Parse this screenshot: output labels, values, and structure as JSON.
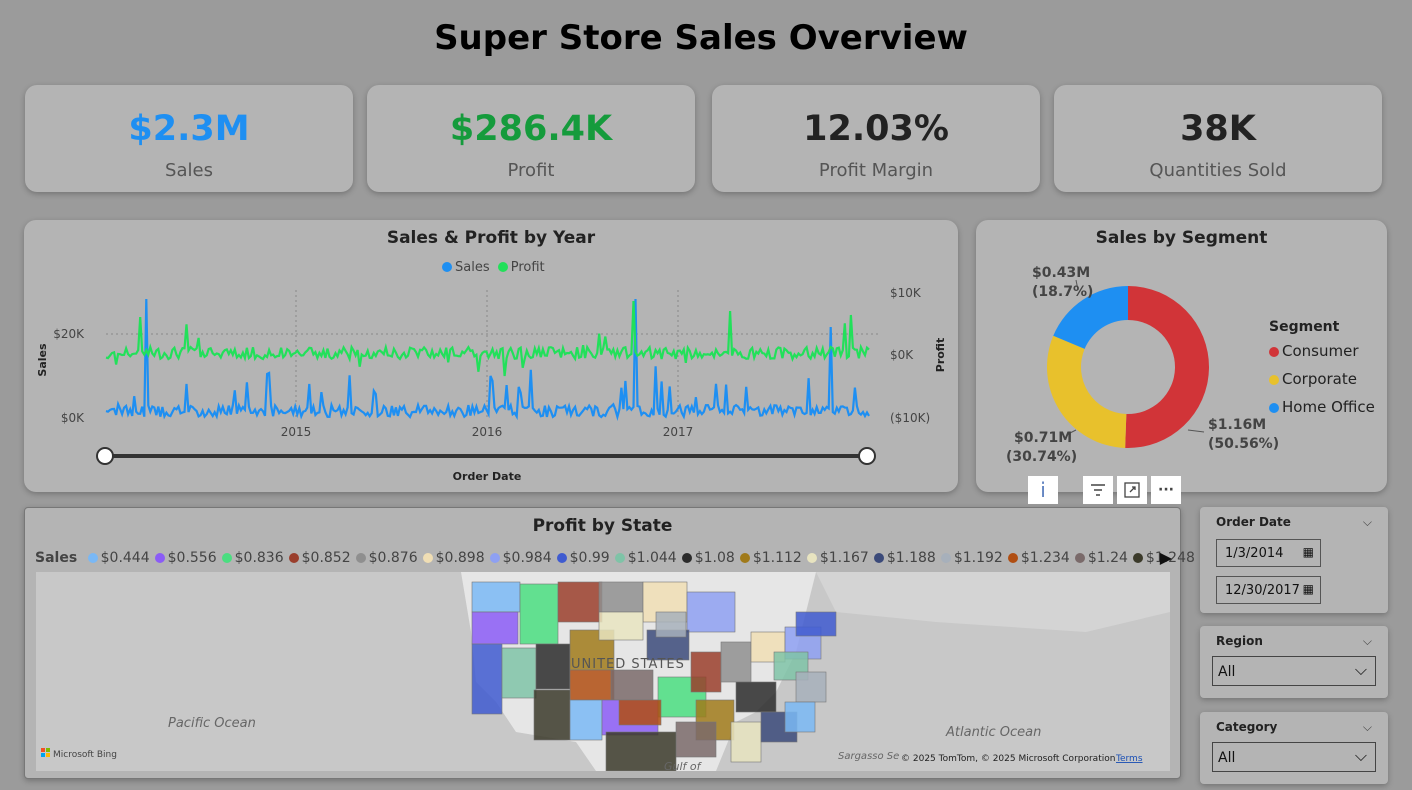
{
  "page": {
    "title": "Super Store Sales Overview"
  },
  "kpis": [
    {
      "value": "$2.3M",
      "label": "Sales",
      "color": "#1e8ff2"
    },
    {
      "value": "$286.4K",
      "label": "Profit",
      "color": "#159b3c"
    },
    {
      "value": "12.03%",
      "label": "Profit Margin",
      "color": "#222222"
    },
    {
      "value": "38K",
      "label": "Quantities Sold",
      "color": "#222222"
    }
  ],
  "line_chart": {
    "title": "Sales & Profit by Year",
    "legend": {
      "sales": "Sales",
      "profit": "Profit"
    },
    "y_left_label": "Sales",
    "y_right_label": "Profit",
    "x_label": "Order Date",
    "y_left_ticks": [
      "$20K",
      "$0K"
    ],
    "y_right_ticks": [
      "$10K",
      "$0K",
      "($10K)"
    ],
    "x_ticks": [
      "2015",
      "2016",
      "2017"
    ],
    "colors": {
      "sales": "#1e8ff2",
      "profit": "#22e05a"
    }
  },
  "donut": {
    "title": "Sales by Segment",
    "legend_title": "Segment",
    "segments": [
      {
        "name": "Consumer",
        "value_label": "$1.16M",
        "pct_label": "(50.56%)",
        "pct": 50.56,
        "color": "#d13438"
      },
      {
        "name": "Corporate",
        "value_label": "$0.71M",
        "pct_label": "(30.74%)",
        "pct": 30.74,
        "color": "#e8c12c"
      },
      {
        "name": "Home Office",
        "value_label": "$0.43M",
        "pct_label": "(18.7%)",
        "pct": 18.7,
        "color": "#1e8ff2"
      }
    ]
  },
  "visual_toolbar": {
    "info": "i",
    "filter": "⩸",
    "focus": "⤢",
    "more": "···"
  },
  "map": {
    "title": "Profit by State",
    "legend_title": "Sales",
    "legend": [
      {
        "label": "$0.444",
        "color": "#7ab8f5"
      },
      {
        "label": "$0.556",
        "color": "#8b5cf6"
      },
      {
        "label": "$0.836",
        "color": "#4ade80"
      },
      {
        "label": "$0.852",
        "color": "#9a3e2c"
      },
      {
        "label": "$0.876",
        "color": "#8f8f8f"
      },
      {
        "label": "$0.898",
        "color": "#f0deb4"
      },
      {
        "label": "$0.984",
        "color": "#8ea0f2"
      },
      {
        "label": "$0.99",
        "color": "#3f5bd0"
      },
      {
        "label": "$1.044",
        "color": "#7fc3a7"
      },
      {
        "label": "$1.08",
        "color": "#2b2b2b"
      },
      {
        "label": "$1.112",
        "color": "#a07a1a"
      },
      {
        "label": "$1.167",
        "color": "#e8e4c0"
      },
      {
        "label": "$1.188",
        "color": "#3b4a7a"
      },
      {
        "label": "$1.192",
        "color": "#a7b0bb"
      },
      {
        "label": "$1.234",
        "color": "#b04e12"
      },
      {
        "label": "$1.24",
        "color": "#7a6a6a"
      },
      {
        "label": "$1.248",
        "color": "#3b3a2a"
      }
    ],
    "country_label": "UNITED STATES",
    "oceans": {
      "pacific": "Pacific Ocean",
      "atlantic": "Atlantic Ocean",
      "gulf": "Gulf of",
      "sargasso": "Sargasso Se"
    },
    "bing_label": "Microsoft Bing",
    "copyright": "© 2025 TomTom, © 2025 Microsoft Corporation",
    "terms": "Terms"
  },
  "slicers": {
    "order_date": {
      "label": "Order Date",
      "start": "1/3/2014",
      "end": "12/30/2017"
    },
    "region": {
      "label": "Region",
      "value": "All"
    },
    "category": {
      "label": "Category",
      "value": "All"
    }
  }
}
